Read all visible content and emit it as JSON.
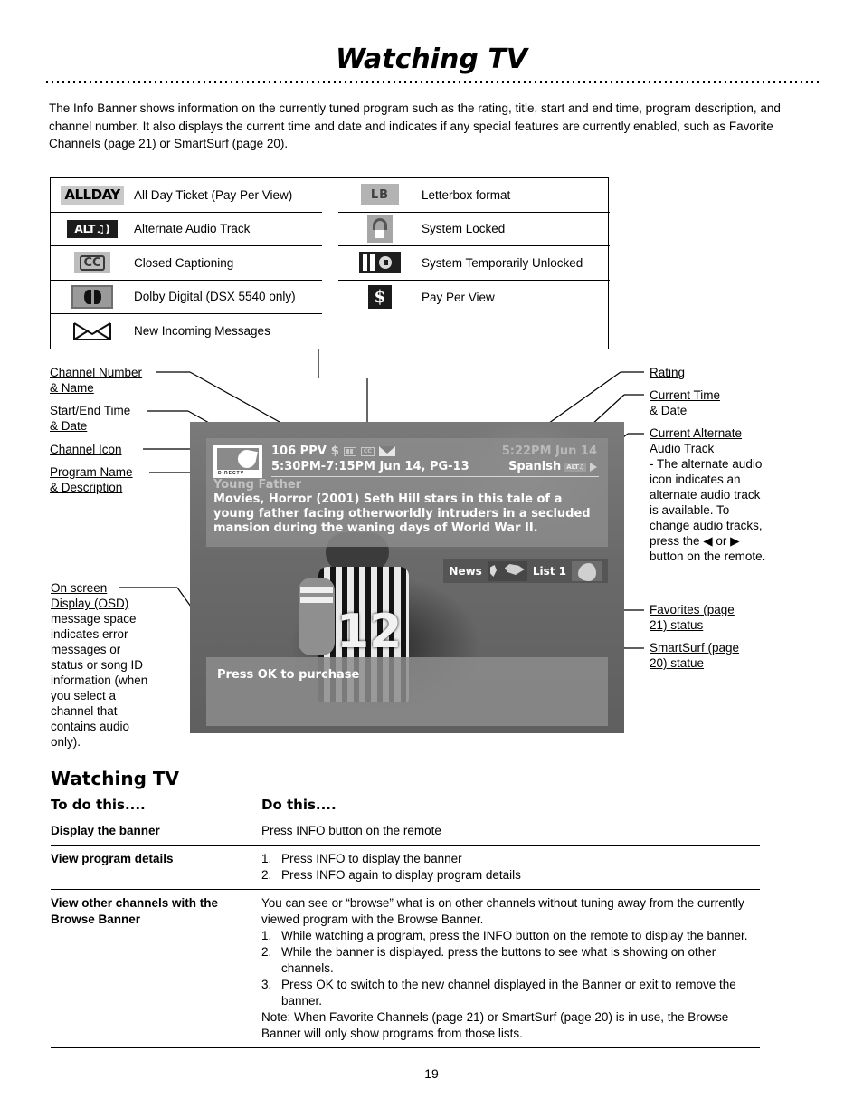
{
  "page": {
    "title": "Watching TV",
    "page_number": "19",
    "intro": "The Info Banner shows information on the currently tuned program such as the rating, title, start and end time, program description, and channel number. It also displays the current time and date and indicates if any special features are currently enabled, such as Favorite Channels (page 21) or SmartSurf (page 20)."
  },
  "legend": {
    "left": [
      {
        "icon": "allday-icon",
        "icon_text": "ALLDAY",
        "label": "All Day Ticket (Pay Per View)"
      },
      {
        "icon": "alternate-audio-icon",
        "icon_text": "ALT",
        "label": "Alternate Audio Track"
      },
      {
        "icon": "closed-captioning-icon",
        "icon_text": "CC",
        "label": "Closed Captioning"
      },
      {
        "icon": "dolby-digital-icon",
        "icon_text": "",
        "label": "Dolby Digital (DSX 5540 only)"
      },
      {
        "icon": "new-messages-icon",
        "icon_text": "",
        "label": "New Incoming Messages"
      }
    ],
    "right": [
      {
        "icon": "letterbox-icon",
        "icon_text": "LB",
        "label": "Letterbox format"
      },
      {
        "icon": "system-locked-icon",
        "icon_text": "",
        "label": "System Locked"
      },
      {
        "icon": "system-temporarily-unlocked-icon",
        "icon_text": "",
        "label": "System Temporarily Unlocked"
      },
      {
        "icon": "pay-per-view-icon",
        "icon_text": "$",
        "label": "Pay Per View"
      }
    ]
  },
  "callouts": {
    "left": [
      {
        "heading": "Channel Number\n& Name",
        "body": ""
      },
      {
        "heading": "Start/End Time\n& Date",
        "body": ""
      },
      {
        "heading": "Channel Icon",
        "body": ""
      },
      {
        "heading": "Program Name\n& Description",
        "body": ""
      }
    ],
    "osd": {
      "heading": "On screen Display (OSD)",
      "body": "message space indicates error messages or status or song ID information (when you select a channel that contains audio only)."
    },
    "right": [
      {
        "heading": "Rating",
        "body": ""
      },
      {
        "heading": "Current Time\n& Date",
        "body": ""
      },
      {
        "heading": "Current Alternate Audio Track",
        "body": "- The alternate audio icon indicates an alternate audio track is available. To change audio tracks, press the ◀ or ▶ button on the remote."
      },
      {
        "heading": "Favorites (page 21) status",
        "body": ""
      },
      {
        "heading": "SmartSurf (page 20) statue",
        "body": ""
      }
    ]
  },
  "tv_banner": {
    "channel_line": "106 PPV",
    "channel_icons": [
      "dollar-icon",
      "dolby-icon",
      "cc-icon",
      "mail-icon"
    ],
    "time_line": "5:30PM-7:15PM Jun 14, PG-13",
    "current_time": "5:22PM Jun 14",
    "audio_track": "Spanish",
    "audio_icon_text": "ALT",
    "program_name": "Young Father",
    "description": "Movies, Horror (2001) Seth Hill stars in this tale of a young father facing otherworldly intruders in a secluded mansion during the waning days of World War II.",
    "logo_text": "DIRECTV",
    "player_number": "12",
    "browse_bar": {
      "favorites_label": "News",
      "list_label": "List 1"
    },
    "osd_message": "Press OK to purchase"
  },
  "howto": {
    "section_title": "Watching TV",
    "col_a_header": "To do this....",
    "col_b_header": "Do this....",
    "rows": [
      {
        "task": "Display the banner",
        "lines": [
          {
            "num": "",
            "text": "Press INFO button on the remote"
          }
        ]
      },
      {
        "task": "View program details",
        "lines": [
          {
            "num": "1.",
            "text": "Press INFO to display the banner"
          },
          {
            "num": "2.",
            "text": "Press INFO again to display program details"
          }
        ]
      },
      {
        "task": "View other channels with the Browse Banner",
        "lines": [
          {
            "num": "",
            "text": "You can see or “browse” what is on other channels without tuning away from the currently viewed program with the Browse Banner."
          },
          {
            "num": "1.",
            "text": "While watching a program, press the INFO button on the remote to display the banner."
          },
          {
            "num": "2.",
            "text": "While the banner is displayed. press the          buttons to see what is showing on other channels."
          },
          {
            "num": "3.",
            "text": "Press OK to switch to the new channel displayed in the Banner or exit to remove the banner."
          },
          {
            "num": "",
            "text": "Note: When Favorite Channels (page 21) or SmartSurf (page 20) is in use, the Browse Banner will only show programs from those lists."
          }
        ]
      }
    ]
  }
}
